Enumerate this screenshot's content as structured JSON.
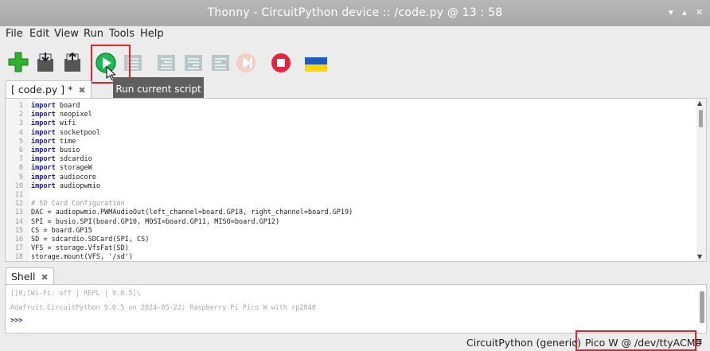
{
  "window": {
    "title": "Thonny  -  CircuitPython device :: /code.py  @  13 : 58",
    "controls": [
      "▾",
      "▴",
      "✕"
    ]
  },
  "menu": [
    "File",
    "Edit",
    "View",
    "Run",
    "Tools",
    "Help"
  ],
  "toolbar": {
    "icons": [
      "new-file-icon",
      "open-file-icon",
      "save-file-icon",
      "run-icon",
      "debug-icon",
      "step-over-icon",
      "step-into-icon",
      "step-out-icon",
      "resume-icon",
      "stop-icon",
      "ukraine-flag-icon"
    ],
    "tooltip": "Run current script"
  },
  "editor_tab": {
    "label": "[ code.py ] *",
    "close": "✖"
  },
  "code_lines": [
    {
      "n": "1",
      "kw": "import",
      "rest": " board"
    },
    {
      "n": "2",
      "kw": "import",
      "rest": " neopixel"
    },
    {
      "n": "3",
      "kw": "import",
      "rest": " wifi"
    },
    {
      "n": "4",
      "kw": "import",
      "rest": " socketpool"
    },
    {
      "n": "5",
      "kw": "import",
      "rest": " time"
    },
    {
      "n": "6",
      "kw": "import",
      "rest": " busio"
    },
    {
      "n": "7",
      "kw": "import",
      "rest": " sdcardio"
    },
    {
      "n": "8",
      "kw": "import",
      "rest": " storageW"
    },
    {
      "n": "9",
      "kw": "import",
      "rest": " audiocore"
    },
    {
      "n": "10",
      "kw": "import",
      "rest": " audiopwmio"
    },
    {
      "n": "11",
      "kw": "",
      "rest": ""
    },
    {
      "n": "12",
      "kw": "",
      "rest": "",
      "comment": "# SD Card Configuration"
    },
    {
      "n": "13",
      "kw": "",
      "rest": "DAC = audiopwmio.PWMAudioOut(left_channel=board.GP18, right_channel=board.GP19)"
    },
    {
      "n": "14",
      "kw": "",
      "rest": "SPI = busio.SPI(board.GP10, MOSI=board.GP11, MISO=board.GP12)"
    },
    {
      "n": "15",
      "kw": "",
      "rest": "CS = board.GP15"
    },
    {
      "n": "16",
      "kw": "",
      "rest": "SD = sdcardio.SDCard(SPI, CS)"
    },
    {
      "n": "17",
      "kw": "",
      "rest": "VFS = storage.VfsFat(SD)"
    },
    {
      "n": "18",
      "kw": "",
      "rest": "storage.mount(VFS, '/sd')"
    }
  ],
  "shell_tab": {
    "label": "Shell",
    "close": "✖"
  },
  "shell_lines": [
    "[]0;[Wi-Fi: off | REPL | 9.0.5[\\",
    "Adafruit CircuitPython 9.0.5 on 2024-05-22; Raspberry Pi Pico W with rp2040"
  ],
  "shell_prompt": ">>>",
  "status": {
    "interpreter": "CircuitPython (generic)",
    "separator": "•",
    "device": "Pico W @ /dev/ttyACM0",
    "menu_icon": "≡"
  },
  "colors": {
    "accent_red": "#e0242b",
    "keyword": "#1a1aa6",
    "run_green": "#1db954"
  }
}
